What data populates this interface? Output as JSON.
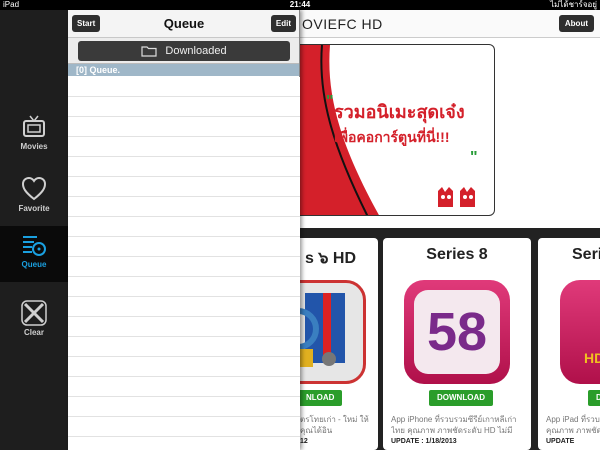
{
  "status": {
    "device": "iPad",
    "time": "21:44",
    "carrier": "ไม่ได้ชาร์จอยู่"
  },
  "menu": {
    "items": [
      {
        "label": "Movies",
        "icon": "tv-icon"
      },
      {
        "label": "Favorite",
        "icon": "heart-icon"
      },
      {
        "label": "Queue",
        "icon": "queue-icon"
      },
      {
        "label": "Clear",
        "icon": "clear-icon"
      }
    ],
    "active_index": 2,
    "active_color": "#1aa0e0"
  },
  "panel": {
    "title": "Queue",
    "start_label": "Start",
    "edit_label": "Edit",
    "downloaded_label": "Downloaded",
    "queue_row": "[0] Queue."
  },
  "site": {
    "title": "OVIEFC HD",
    "about_label": "About",
    "banner_line1": "รวมอนิเมะสุดเจ๋ง",
    "banner_line2": "เพื่อคอการ์ตูนที่นี่!!!",
    "cards": [
      {
        "title": "s ๖ HD",
        "download": "NLOAD",
        "desc": "ตรโทยเก่า - ใหม่ ให้คุณได้อิน",
        "update": "12"
      },
      {
        "title": "Series 8",
        "download": "DOWNLOAD",
        "desc": "App iPhone ที่รวบรวมซีรีย์เกาหลีเก่าไทย คุณภาพ ภาพชัดระดับ HD ไม่มีการแบ่ง",
        "update": "UPDATE : 1/18/2013",
        "icon_text": "58"
      },
      {
        "title": "Seri",
        "download": "D",
        "desc": "App iPad ที่รวบ คุณภาพ ภาพชัด",
        "update": "UPDATE"
      }
    ]
  }
}
